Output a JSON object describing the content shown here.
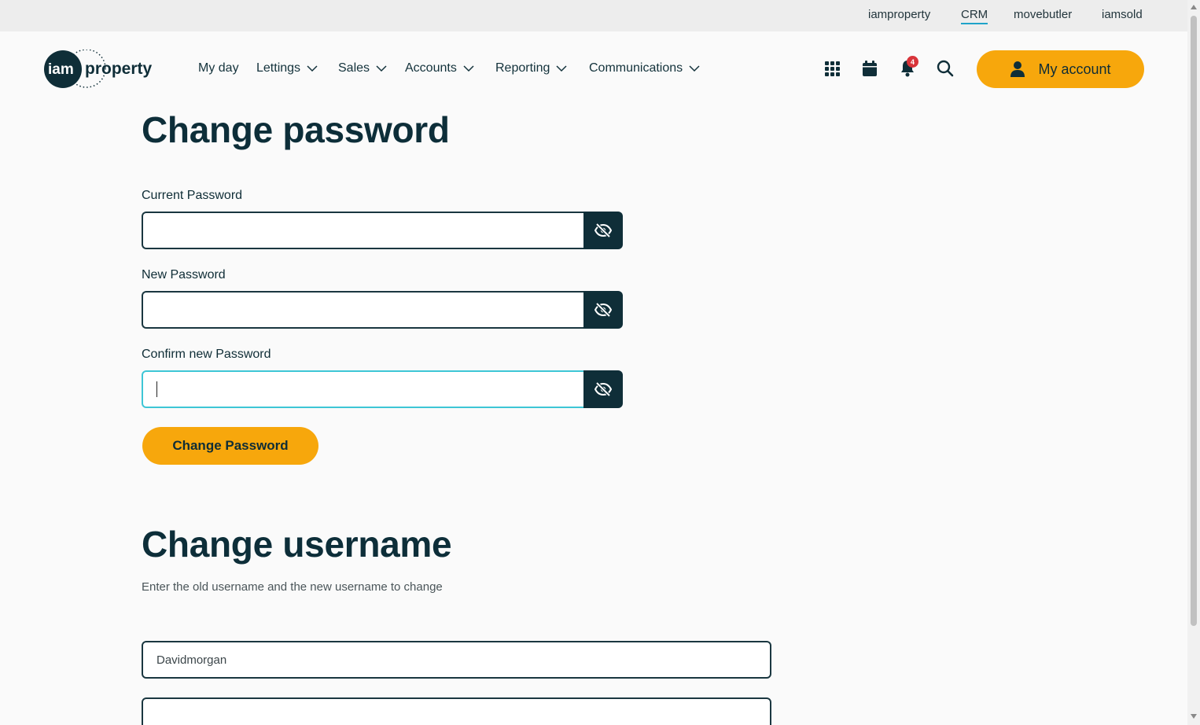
{
  "topbar": {
    "links": [
      {
        "label": "iamproperty"
      },
      {
        "label": "CRM"
      },
      {
        "label": "movebutler"
      },
      {
        "label": "iamsold"
      }
    ]
  },
  "header": {
    "logo": {
      "part1": "iam",
      "part2": "property"
    },
    "nav": [
      {
        "label": "My day"
      },
      {
        "label": "Lettings"
      },
      {
        "label": "Sales"
      },
      {
        "label": "Accounts"
      },
      {
        "label": "Reporting"
      },
      {
        "label": "Communications"
      }
    ],
    "icons": [
      "apps-grid-icon",
      "calendar-icon",
      "bell-icon",
      "search-icon"
    ],
    "notification_count": "4",
    "account_label": "My account"
  },
  "change_password": {
    "title": "Change password",
    "current_label": "Current Password",
    "new_label": "New Password",
    "confirm_label": "Confirm new Password",
    "button_label": "Change Password"
  },
  "change_username": {
    "title": "Change username",
    "description": "Enter the old username and the new username to change",
    "old_username_value": "Davidmorgan",
    "new_username_value": ""
  },
  "colors": {
    "accent": "#f7a70c",
    "dark": "#0f2e38",
    "focus": "#3ec6d6",
    "badge": "#d8343a"
  }
}
